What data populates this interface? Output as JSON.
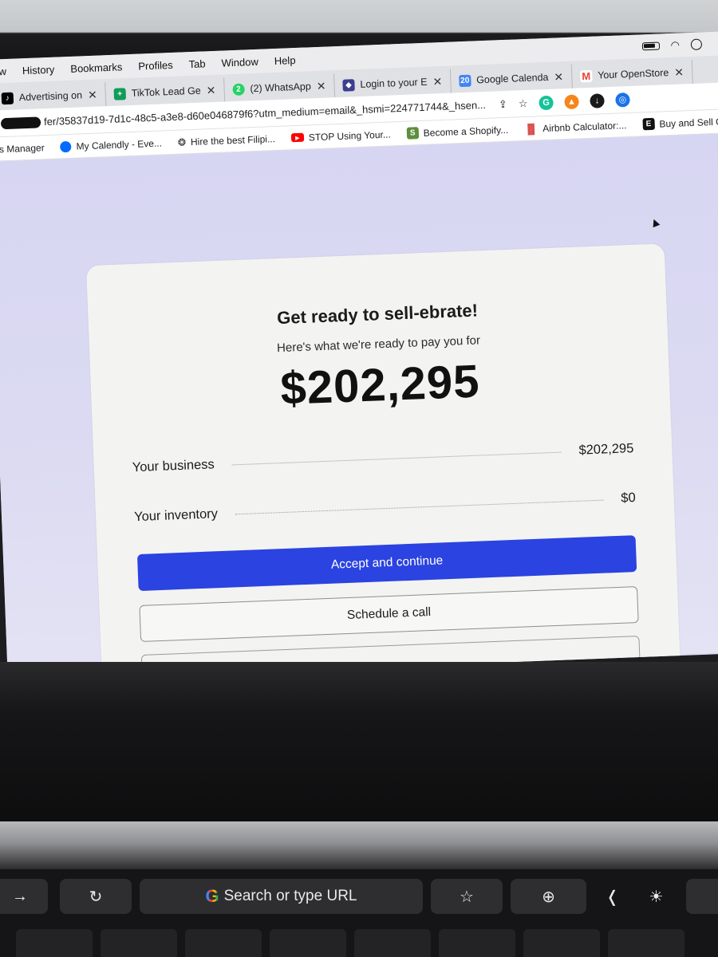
{
  "menubar": {
    "items": [
      "w",
      "History",
      "Bookmarks",
      "Profiles",
      "Tab",
      "Window",
      "Help"
    ]
  },
  "tabs": [
    {
      "label": "Advertising on",
      "icon": "tiktok-icon",
      "color": "#000000"
    },
    {
      "label": "TikTok Lead Ge",
      "icon": "sheets-icon",
      "color": "#0f9d58"
    },
    {
      "label": "(2) WhatsApp",
      "icon": "whatsapp-icon",
      "color": "#25d366"
    },
    {
      "label": "Login to your E",
      "icon": "shield-icon",
      "color": "#3b3f8f"
    },
    {
      "label": "Google Calenda",
      "icon": "calendar-icon",
      "color": "#4285f4"
    },
    {
      "label": "Your OpenStore",
      "icon": "gmail-icon",
      "color": "#ea4335"
    }
  ],
  "address": {
    "url": "fer/35837d19-7d1c-48c5-a3e8-d60e046879f6?utm_medium=email&_hsmi=224771744&_hsen..."
  },
  "bookmarks": [
    {
      "label": "ds Manager",
      "icon": ""
    },
    {
      "label": "My Calendly - Eve...",
      "icon": "calendly-icon"
    },
    {
      "label": "Hire the best Filipi...",
      "icon": "upwork-icon"
    },
    {
      "label": "STOP Using Your...",
      "icon": "youtube-icon"
    },
    {
      "label": "Become a Shopify...",
      "icon": "shopify-icon"
    },
    {
      "label": "Airbnb Calculator:...",
      "icon": "chart-icon"
    },
    {
      "label": "Buy and Sell Onlin",
      "icon": "e-icon"
    }
  ],
  "offer": {
    "title": "Get ready to sell-ebrate!",
    "subtitle": "Here's what we're ready to pay you for",
    "amount": "$202,295",
    "business_label": "Your business",
    "business_value": "$202,295",
    "inventory_label": "Your inventory",
    "inventory_value": "$0",
    "accept_label": "Accept and continue",
    "schedule_label": "Schedule a call"
  },
  "touchbar": {
    "search_placeholder": "Search or type URL"
  },
  "colors": {
    "primary_button": "#2b43e0",
    "page_background": "#d7d6f2"
  }
}
